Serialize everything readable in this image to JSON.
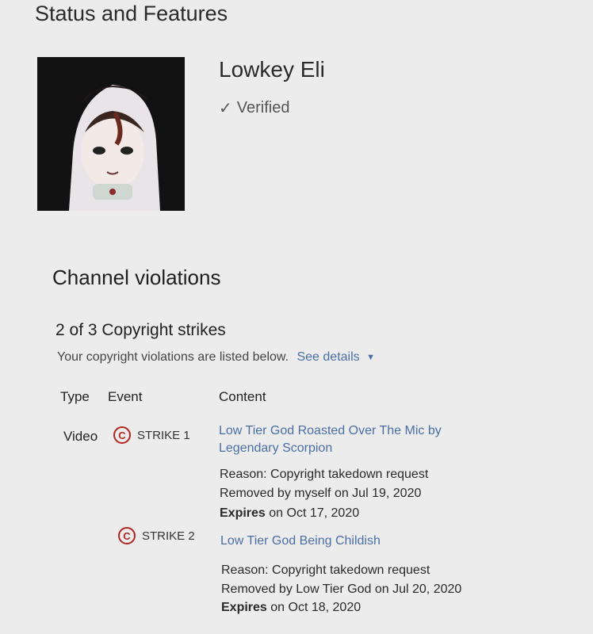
{
  "page": {
    "title": "Status and Features"
  },
  "channel": {
    "name": "Lowkey Eli",
    "status": "Verified"
  },
  "violations": {
    "title": "Channel violations",
    "strike_summary": "2 of 3 Copyright strikes",
    "description": "Your copyright violations are listed below.",
    "details_link": "See details",
    "columns": {
      "type": "Type",
      "event": "Event",
      "content": "Content"
    },
    "rows": [
      {
        "type": "Video",
        "strike_label": "STRIKE 1",
        "content_title_line1": "Low Tier God Roasted Over The Mic by",
        "content_title_line2": "Legendary Scorpion",
        "reason": "Reason: Copyright takedown request",
        "removed": "Removed by myself on Jul 19, 2020",
        "expires_label": "Expires",
        "expires_rest": " on Oct 17, 2020"
      },
      {
        "type": "",
        "strike_label": "STRIKE 2",
        "content_title_line1": "Low Tier God Being Childish",
        "reason": "Reason: Copyright takedown request",
        "removed": "Removed by Low Tier God on Jul 20, 2020",
        "expires_label": "Expires",
        "expires_rest": " on Oct 18, 2020"
      }
    ]
  },
  "icons": {
    "verified": "checkmark-icon",
    "strike": "copyright-icon",
    "details": "caret-down-icon"
  },
  "colors": {
    "link": "#4a6fa5",
    "strike_icon": "#b3261e"
  }
}
